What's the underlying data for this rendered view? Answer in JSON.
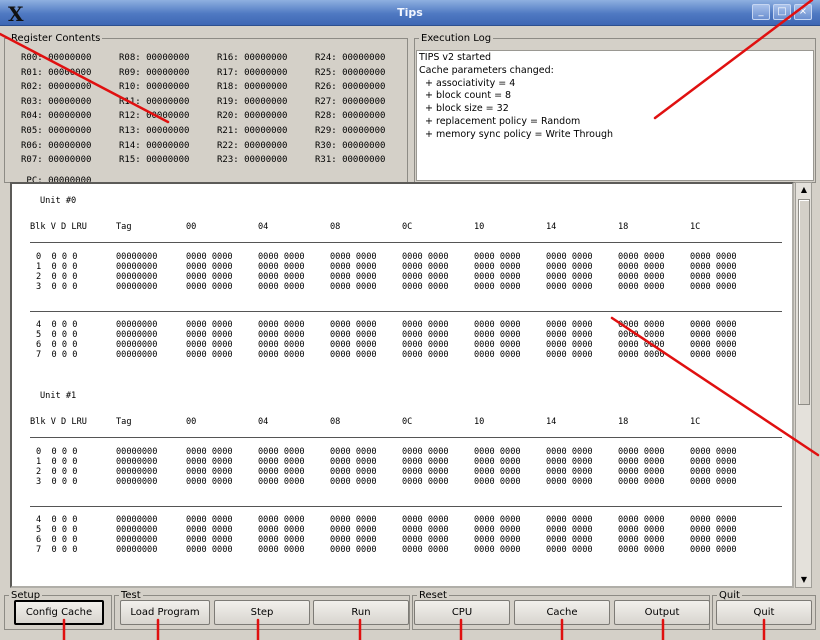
{
  "window": {
    "title": "Tips",
    "logo": "X",
    "buttons": [
      "_",
      "□",
      "×"
    ]
  },
  "registers": {
    "legend": "Register Contents",
    "rows": [
      [
        "R00: 00000000",
        "R08: 00000000",
        "R16: 00000000",
        "R24: 00000000"
      ],
      [
        "R01: 00000000",
        "R09: 00000000",
        "R17: 00000000",
        "R25: 00000000"
      ],
      [
        "R02: 00000000",
        "R10: 00000000",
        "R18: 00000000",
        "R26: 00000000"
      ],
      [
        "R03: 00000000",
        "R11: 00000000",
        "R19: 00000000",
        "R27: 00000000"
      ],
      [
        "R04: 00000000",
        "R12: 00000000",
        "R20: 00000000",
        "R28: 00000000"
      ],
      [
        "R05: 00000000",
        "R13: 00000000",
        "R21: 00000000",
        "R29: 00000000"
      ],
      [
        "R06: 00000000",
        "R14: 00000000",
        "R22: 00000000",
        "R30: 00000000"
      ],
      [
        "R07: 00000000",
        "R15: 00000000",
        "R23: 00000000",
        "R31: 00000000"
      ]
    ],
    "pc": " PC: 00000000"
  },
  "log": {
    "legend": "Execution Log",
    "lines": [
      "TIPS v2 started",
      "Cache parameters changed:",
      "  + associativity = 4",
      "  + block count = 8",
      "  + block size = 32",
      "  + replacement policy = Random",
      "  + memory sync policy = Write Through"
    ]
  },
  "cache": {
    "headers": [
      "Blk V D LRU",
      "Tag",
      "00",
      "04",
      "08",
      "0C",
      "10",
      "14",
      "18",
      "1C"
    ],
    "units": [
      {
        "title": "Unit #0",
        "rows": [
          [
            "0  0 0 0",
            "00000000",
            "0000 0000",
            "0000 0000",
            "0000 0000",
            "0000 0000",
            "0000 0000",
            "0000 0000",
            "0000 0000",
            "0000 0000"
          ],
          [
            "1  0 0 0",
            "00000000",
            "0000 0000",
            "0000 0000",
            "0000 0000",
            "0000 0000",
            "0000 0000",
            "0000 0000",
            "0000 0000",
            "0000 0000"
          ],
          [
            "2  0 0 0",
            "00000000",
            "0000 0000",
            "0000 0000",
            "0000 0000",
            "0000 0000",
            "0000 0000",
            "0000 0000",
            "0000 0000",
            "0000 0000"
          ],
          [
            "3  0 0 0",
            "00000000",
            "0000 0000",
            "0000 0000",
            "0000 0000",
            "0000 0000",
            "0000 0000",
            "0000 0000",
            "0000 0000",
            "0000 0000"
          ],
          [
            "4  0 0 0",
            "00000000",
            "0000 0000",
            "0000 0000",
            "0000 0000",
            "0000 0000",
            "0000 0000",
            "0000 0000",
            "0000 0000",
            "0000 0000"
          ],
          [
            "5  0 0 0",
            "00000000",
            "0000 0000",
            "0000 0000",
            "0000 0000",
            "0000 0000",
            "0000 0000",
            "0000 0000",
            "0000 0000",
            "0000 0000"
          ],
          [
            "6  0 0 0",
            "00000000",
            "0000 0000",
            "0000 0000",
            "0000 0000",
            "0000 0000",
            "0000 0000",
            "0000 0000",
            "0000 0000",
            "0000 0000"
          ],
          [
            "7  0 0 0",
            "00000000",
            "0000 0000",
            "0000 0000",
            "0000 0000",
            "0000 0000",
            "0000 0000",
            "0000 0000",
            "0000 0000",
            "0000 0000"
          ]
        ]
      },
      {
        "title": "Unit #1",
        "rows": [
          [
            "0  0 0 0",
            "00000000",
            "0000 0000",
            "0000 0000",
            "0000 0000",
            "0000 0000",
            "0000 0000",
            "0000 0000",
            "0000 0000",
            "0000 0000"
          ],
          [
            "1  0 0 0",
            "00000000",
            "0000 0000",
            "0000 0000",
            "0000 0000",
            "0000 0000",
            "0000 0000",
            "0000 0000",
            "0000 0000",
            "0000 0000"
          ],
          [
            "2  0 0 0",
            "00000000",
            "0000 0000",
            "0000 0000",
            "0000 0000",
            "0000 0000",
            "0000 0000",
            "0000 0000",
            "0000 0000",
            "0000 0000"
          ],
          [
            "3  0 0 0",
            "00000000",
            "0000 0000",
            "0000 0000",
            "0000 0000",
            "0000 0000",
            "0000 0000",
            "0000 0000",
            "0000 0000",
            "0000 0000"
          ],
          [
            "4  0 0 0",
            "00000000",
            "0000 0000",
            "0000 0000",
            "0000 0000",
            "0000 0000",
            "0000 0000",
            "0000 0000",
            "0000 0000",
            "0000 0000"
          ],
          [
            "5  0 0 0",
            "00000000",
            "0000 0000",
            "0000 0000",
            "0000 0000",
            "0000 0000",
            "0000 0000",
            "0000 0000",
            "0000 0000",
            "0000 0000"
          ],
          [
            "6  0 0 0",
            "00000000",
            "0000 0000",
            "0000 0000",
            "0000 0000",
            "0000 0000",
            "0000 0000",
            "0000 0000",
            "0000 0000",
            "0000 0000"
          ],
          [
            "7  0 0 0",
            "00000000",
            "0000 0000",
            "0000 0000",
            "0000 0000",
            "0000 0000",
            "0000 0000",
            "0000 0000",
            "0000 0000",
            "0000 0000"
          ]
        ]
      }
    ]
  },
  "controls": {
    "setup": {
      "legend": "Setup",
      "config_cache": "Config Cache"
    },
    "test": {
      "legend": "Test",
      "load_program": "Load Program",
      "step": "Step",
      "run": "Run"
    },
    "reset": {
      "legend": "Reset",
      "cpu": "CPU",
      "cache": "Cache",
      "output": "Output"
    },
    "quit": {
      "legend": "Quit",
      "quit": "Quit"
    }
  },
  "annotation_color": "#e01010"
}
